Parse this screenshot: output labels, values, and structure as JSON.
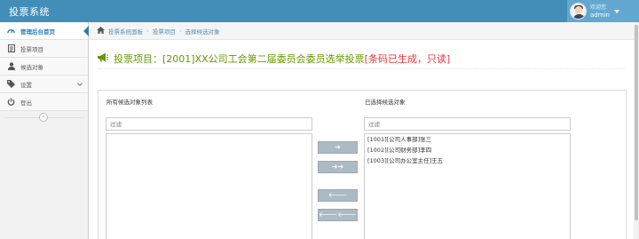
{
  "app": {
    "title": "投票系统"
  },
  "user": {
    "greeting": "欢迎您",
    "name": "admin"
  },
  "sidebar": {
    "items": [
      {
        "label": "管理后台首页",
        "icon": "dashboard-icon",
        "active": true
      },
      {
        "label": "投票项目",
        "icon": "list-icon"
      },
      {
        "label": "候选对象",
        "icon": "user-icon"
      },
      {
        "label": "设置",
        "icon": "tag-icon",
        "has_submenu": true
      },
      {
        "label": "登出",
        "icon": "power-icon"
      }
    ],
    "collapse_glyph": "«"
  },
  "breadcrumb": [
    "投票系统面板",
    "投票项目",
    "选择候选对象"
  ],
  "page": {
    "title_prefix": "投票项目：[2001]XX公司工会第二届委员会委员选举投票",
    "title_status": "[条码已生成，只读]"
  },
  "picker": {
    "left_label": "所有候选对象列表",
    "right_label": "已选择候选对象",
    "left_filter_placeholder": "过滤",
    "right_filter_placeholder": "过滤",
    "available": [],
    "selected": [
      "[1001][公司人事部]张三",
      "[1002][公司财务部]李四",
      "[1003][公司办公室主任]王五"
    ],
    "buttons": {
      "move_selected": "➔",
      "move_all": "➔➔",
      "remove_selected": "🡐",
      "remove_all": "🡐🡐"
    }
  },
  "colors": {
    "navbar": "#438eb9",
    "title_green": "#669900",
    "title_red": "#e53935",
    "button_gray": "#abbac3",
    "link_blue": "#4c8fbd"
  }
}
